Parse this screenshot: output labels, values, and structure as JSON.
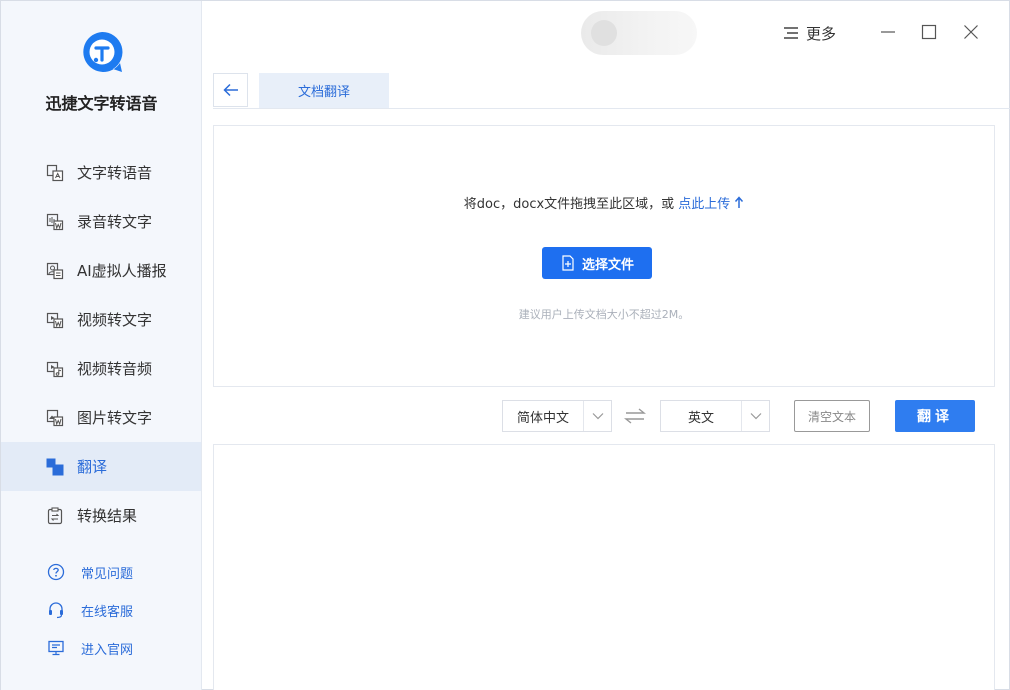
{
  "app": {
    "name": "迅捷文字转语音",
    "brand_color": "#1e6ff0"
  },
  "sidebar": {
    "items": [
      {
        "label": "文字转语音",
        "icon": "text-to-speech-icon",
        "active": false
      },
      {
        "label": "录音转文字",
        "icon": "audio-to-text-icon",
        "active": false
      },
      {
        "label": "AI虚拟人播报",
        "icon": "ai-avatar-icon",
        "active": false
      },
      {
        "label": "视频转文字",
        "icon": "video-to-text-icon",
        "active": false
      },
      {
        "label": "视频转音频",
        "icon": "video-to-audio-icon",
        "active": false
      },
      {
        "label": "图片转文字",
        "icon": "image-to-text-icon",
        "active": false
      },
      {
        "label": "翻译",
        "icon": "translate-icon",
        "active": true
      },
      {
        "label": "转换结果",
        "icon": "results-icon",
        "active": false
      }
    ],
    "links": [
      {
        "label": "常见问题",
        "icon": "help-icon"
      },
      {
        "label": "在线客服",
        "icon": "headset-icon"
      },
      {
        "label": "进入官网",
        "icon": "monitor-icon"
      }
    ]
  },
  "titlebar": {
    "more_label": "更多"
  },
  "tabs": {
    "active_label": "文档翻译"
  },
  "upload": {
    "hint": "将doc，docx文件拖拽至此区域，或",
    "link_label": "点此上传",
    "button_label": "选择文件",
    "note": "建议用户上传文档大小不超过2M。"
  },
  "translate_bar": {
    "source_lang": "简体中文",
    "target_lang": "英文",
    "clear_label": "清空文本",
    "translate_label": "翻译"
  }
}
